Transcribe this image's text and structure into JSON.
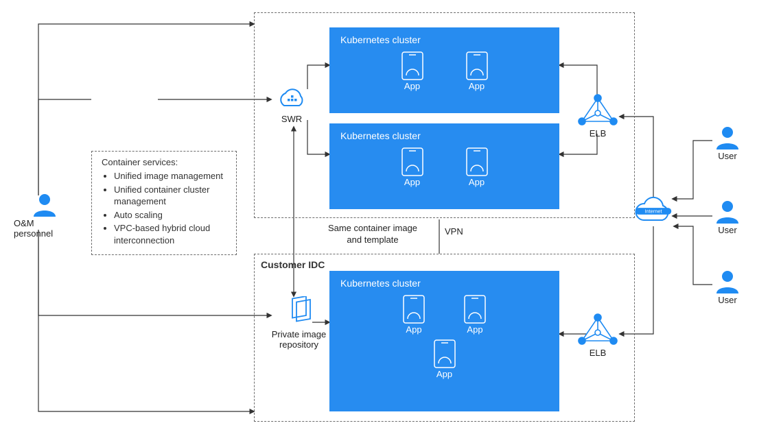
{
  "om": {
    "label": "O&M personnel"
  },
  "services": {
    "title": "Container services:",
    "items": [
      "Unified image management",
      "Unified container cluster management",
      "Auto scaling",
      "VPC-based hybrid cloud interconnection"
    ]
  },
  "swr": {
    "label": "SWR"
  },
  "cloud_box": {},
  "idc_box": {
    "title": "Customer IDC"
  },
  "private_repo": {
    "label": "Private image\nrepository"
  },
  "link_labels": {
    "same_template": "Same container image\nand template",
    "vpn": "VPN"
  },
  "cluster_top": {
    "title": "Kubernetes cluster",
    "apps": [
      "App",
      "App"
    ]
  },
  "cluster_mid": {
    "title": "Kubernetes cluster",
    "apps": [
      "App",
      "App"
    ]
  },
  "cluster_bottom": {
    "title": "Kubernetes cluster",
    "apps": [
      "App",
      "App",
      "App"
    ]
  },
  "elb": {
    "top_label": "ELB",
    "bottom_label": "ELB"
  },
  "internet": {
    "label": "Internet"
  },
  "users": {
    "labels": [
      "User",
      "User",
      "User"
    ]
  }
}
